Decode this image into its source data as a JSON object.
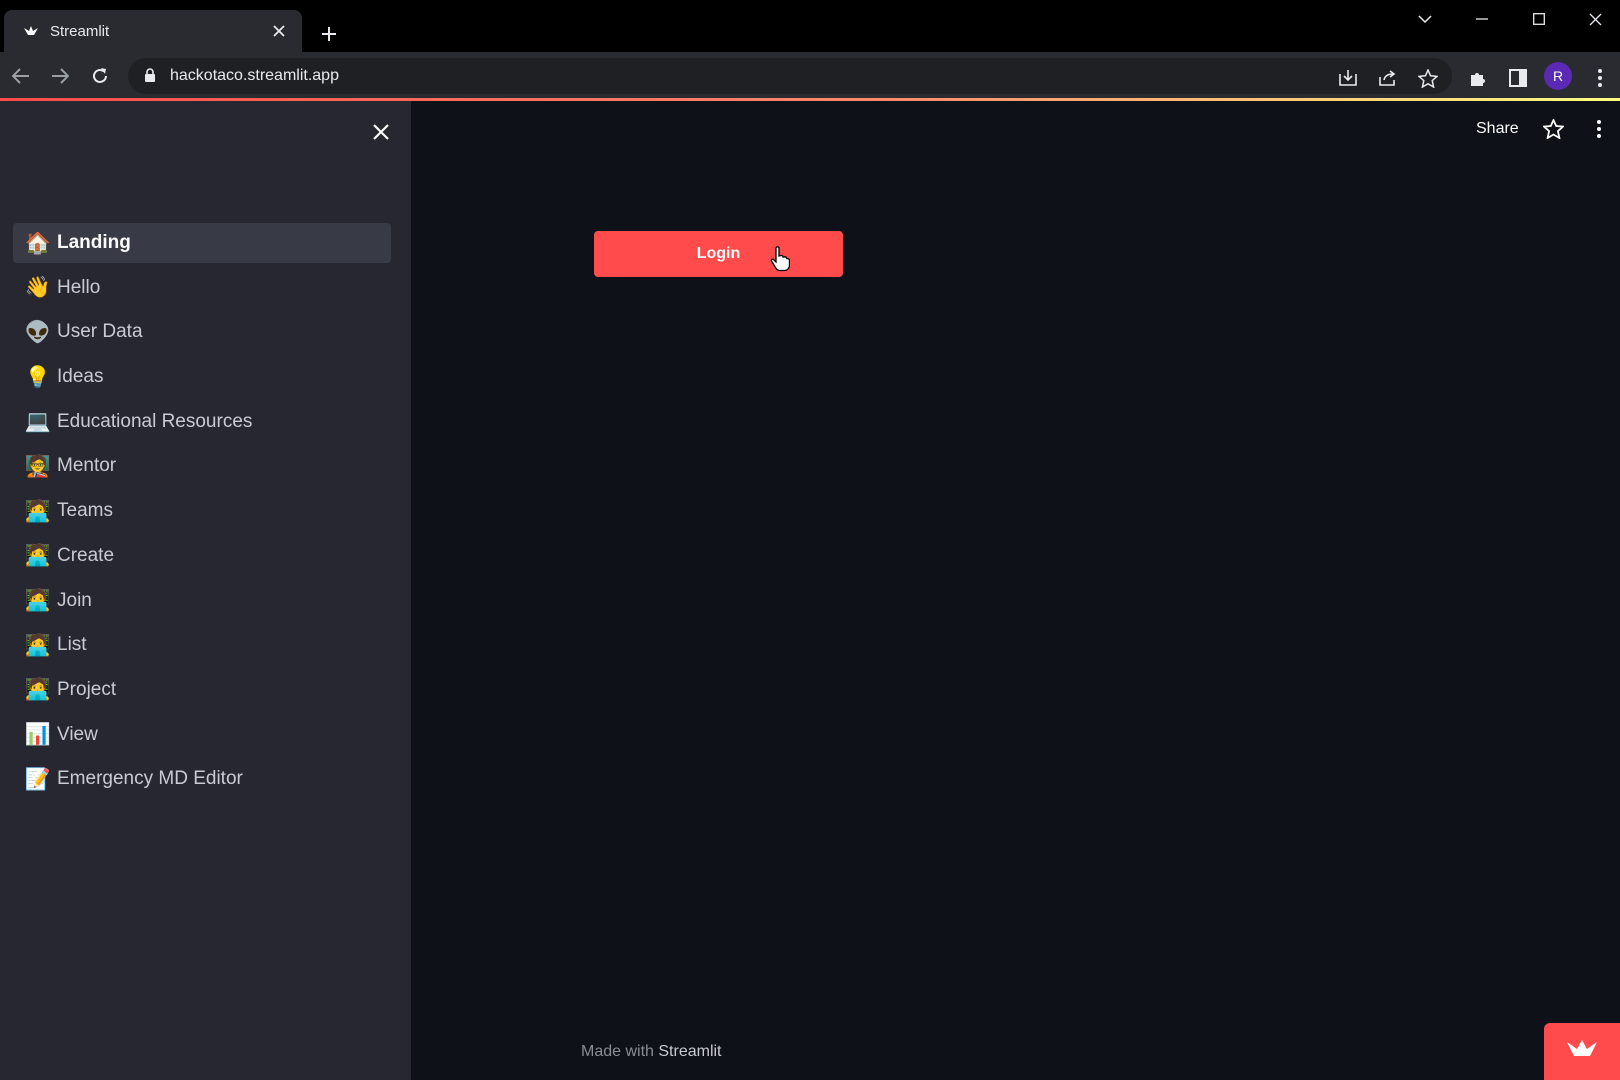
{
  "browser": {
    "tab_title": "Streamlit",
    "url": "hackotaco.streamlit.app",
    "profile_initial": "R"
  },
  "app": {
    "header": {
      "share_label": "Share"
    },
    "sidebar": {
      "items": [
        {
          "icon": "house-icon",
          "glyph": "🏠",
          "label": "Landing",
          "active": true
        },
        {
          "icon": "waving-hand-icon",
          "glyph": "👋",
          "label": "Hello"
        },
        {
          "icon": "alien-icon",
          "glyph": "👽",
          "label": "User Data"
        },
        {
          "icon": "lightbulb-icon",
          "glyph": "💡",
          "label": "Ideas"
        },
        {
          "icon": "laptop-icon",
          "glyph": "💻",
          "label": "Educational Resources"
        },
        {
          "icon": "teacher-icon",
          "glyph": "🧑‍🏫",
          "label": "Mentor"
        },
        {
          "icon": "technologist-icon",
          "glyph": "🧑‍💻",
          "label": "Teams"
        },
        {
          "icon": "technologist-icon",
          "glyph": "🧑‍💻",
          "label": "Create"
        },
        {
          "icon": "technologist-icon",
          "glyph": "🧑‍💻",
          "label": "Join"
        },
        {
          "icon": "technologist-icon",
          "glyph": "🧑‍💻",
          "label": "List"
        },
        {
          "icon": "technologist-icon",
          "glyph": "🧑‍💻",
          "label": "Project"
        },
        {
          "icon": "bar-chart-icon",
          "glyph": "📊",
          "label": "View"
        },
        {
          "icon": "memo-icon",
          "glyph": "📝",
          "label": "Emergency MD Editor"
        }
      ]
    },
    "main": {
      "login_label": "Login"
    },
    "footer": {
      "prefix": "Made with",
      "brand": "Streamlit"
    }
  },
  "colors": {
    "primary": "#ff4b4b",
    "background": "#0e1117",
    "sidebar": "#262730"
  }
}
